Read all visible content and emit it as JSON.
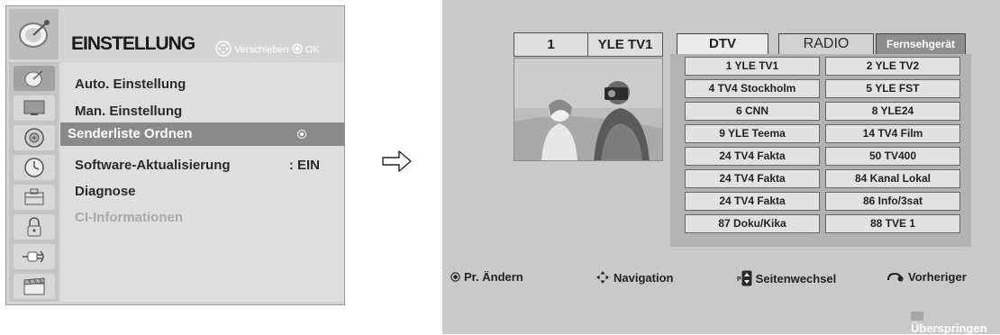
{
  "left_menu": {
    "title": "EINSTELLUNG",
    "hints": {
      "move": "Verschieben",
      "ok": "OK"
    },
    "icons": [
      "satellite-dish-icon",
      "picture-icon",
      "speaker-icon",
      "clock-icon",
      "toolbox-icon",
      "lock-icon",
      "plug-icon",
      "film-icon"
    ],
    "items": [
      {
        "label": "Auto. Einstellung",
        "value": ""
      },
      {
        "label": "Man. Einstellung",
        "value": ""
      },
      {
        "label": "Senderliste Ordnen",
        "value": ""
      },
      {
        "label": "Software-Aktualisierung",
        "value": ": EIN"
      },
      {
        "label": "Diagnose",
        "value": ""
      },
      {
        "label": "CI-Informationen",
        "value": ""
      }
    ]
  },
  "channel_editor": {
    "current_number": "1",
    "current_name": "YLE TV1",
    "tabs": [
      "DTV",
      "RADIO",
      "Fernsehgerät"
    ],
    "channels": [
      [
        "1 YLE TV1",
        "2 YLE TV2"
      ],
      [
        "4 TV4 Stockholm",
        "5 YLE FST"
      ],
      [
        "6 CNN",
        "8 YLE24"
      ],
      [
        "9 YLE Teema",
        "14 TV4 Film"
      ],
      [
        "24 TV4 Fakta",
        "50 TV400"
      ],
      [
        "24 TV4 Fakta",
        "84 Kanal Lokal"
      ],
      [
        "24 TV4 Fakta",
        "86 Info/3sat"
      ],
      [
        "87 Doku/Kika",
        "88 TVE 1"
      ]
    ],
    "footer": {
      "change": "Pr. Ändern",
      "navigation": "Navigation",
      "page": "Seitenwechsel",
      "previous": "Vorheriger",
      "skip": "Überspringen",
      "page_key": "P"
    }
  }
}
